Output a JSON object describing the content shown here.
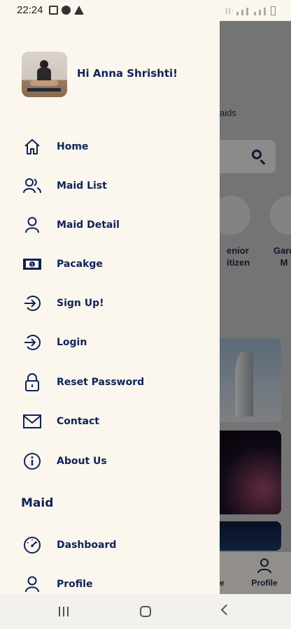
{
  "status_bar": {
    "time": "22:24"
  },
  "drawer": {
    "greeting": "Hi Anna Shrishti!",
    "menu": [
      {
        "label": "Home",
        "icon": "home-icon"
      },
      {
        "label": "Maid List",
        "icon": "users-icon"
      },
      {
        "label": "Maid Detail",
        "icon": "user-icon"
      },
      {
        "label": "Pacakge",
        "icon": "banknote-icon"
      },
      {
        "label": "Sign Up!",
        "icon": "login-arrow-icon"
      },
      {
        "label": "Login",
        "icon": "login-arrow-icon"
      },
      {
        "label": "Reset Password",
        "icon": "lock-icon"
      },
      {
        "label": "Contact",
        "icon": "mail-icon"
      },
      {
        "label": "About Us",
        "icon": "info-icon"
      }
    ],
    "section_title": "Maid",
    "section_menu": [
      {
        "label": "Dashboard",
        "icon": "speedometer-icon"
      },
      {
        "label": "Profile",
        "icon": "user-icon"
      }
    ]
  },
  "background_app": {
    "section_fragment": "aids",
    "category_1_line1": "enior",
    "category_1_line2": "itizen",
    "category_2_line1": "Gard",
    "category_2_line2": "M",
    "bottom_nav_partial": "e",
    "bottom_nav_profile": "Profile"
  },
  "colors": {
    "navy": "#0f2258",
    "cream": "#fbf7ee"
  }
}
